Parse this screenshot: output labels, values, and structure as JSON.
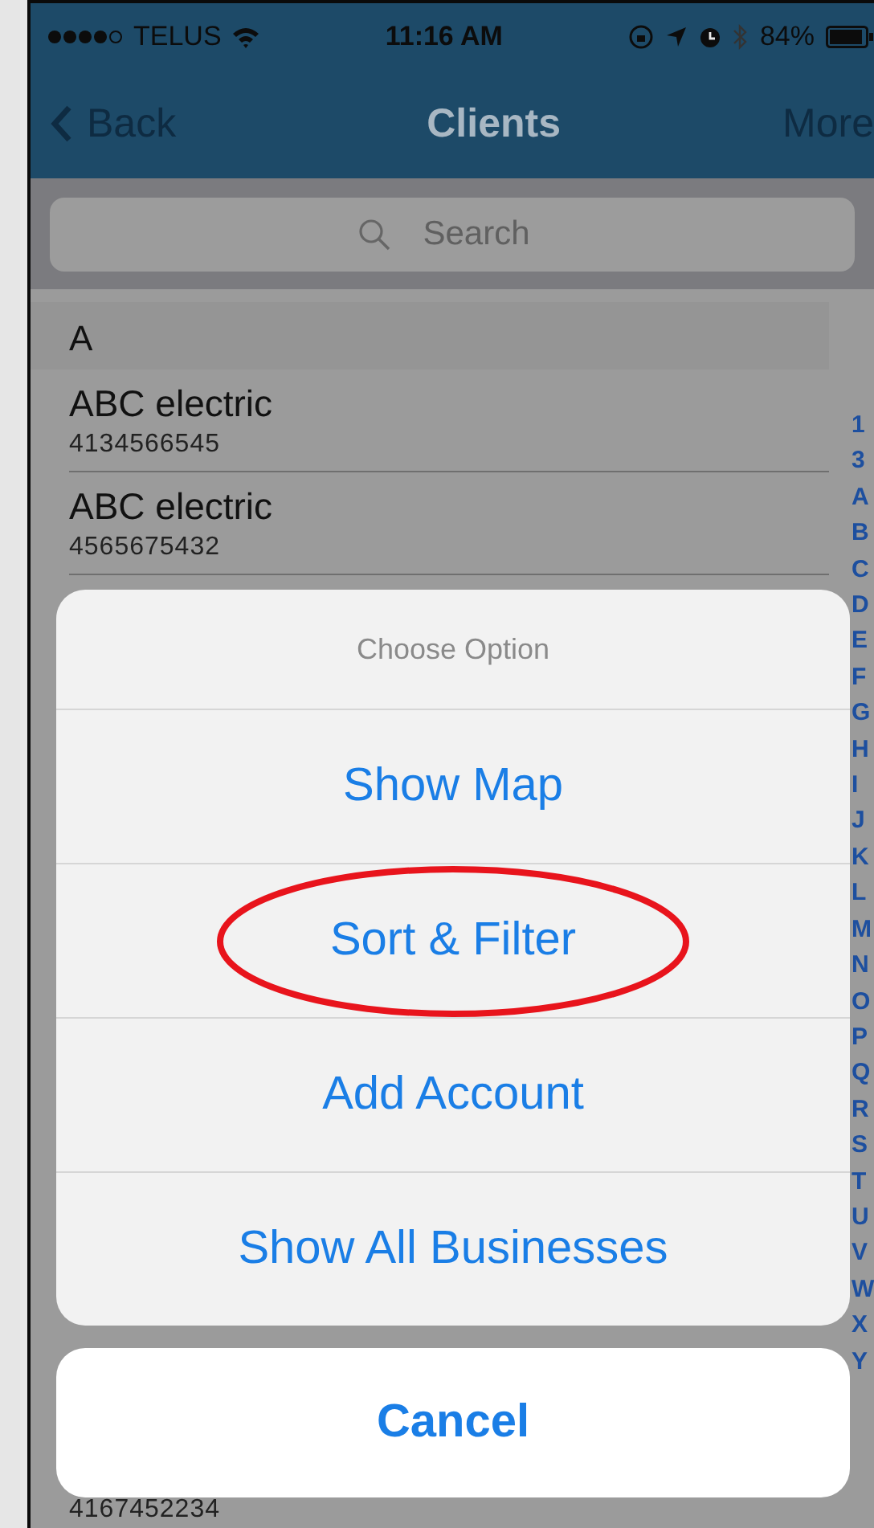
{
  "status_bar": {
    "carrier": "TELUS",
    "time": "11:16 AM",
    "battery": "84%"
  },
  "nav": {
    "back": "Back",
    "title": "Clients",
    "more": "More"
  },
  "search": {
    "placeholder": "Search"
  },
  "list": {
    "section": "A",
    "rows": [
      {
        "name": "ABC electric",
        "phone": "4134566545"
      },
      {
        "name": "ABC electric",
        "phone": "4565675432"
      }
    ],
    "last_phone": "4167452234"
  },
  "index": [
    "1",
    "3",
    "A",
    "B",
    "C",
    "D",
    "E",
    "F",
    "G",
    "H",
    "I",
    "J",
    "K",
    "L",
    "M",
    "N",
    "O",
    "P",
    "Q",
    "R",
    "S",
    "T",
    "U",
    "V",
    "W",
    "X",
    "Y"
  ],
  "sheet": {
    "title": "Choose Option",
    "options": [
      {
        "label": "Show Map",
        "highlighted": false
      },
      {
        "label": "Sort & Filter",
        "highlighted": true
      },
      {
        "label": "Add Account",
        "highlighted": false
      },
      {
        "label": "Show All Businesses",
        "highlighted": false
      }
    ],
    "cancel": "Cancel"
  }
}
